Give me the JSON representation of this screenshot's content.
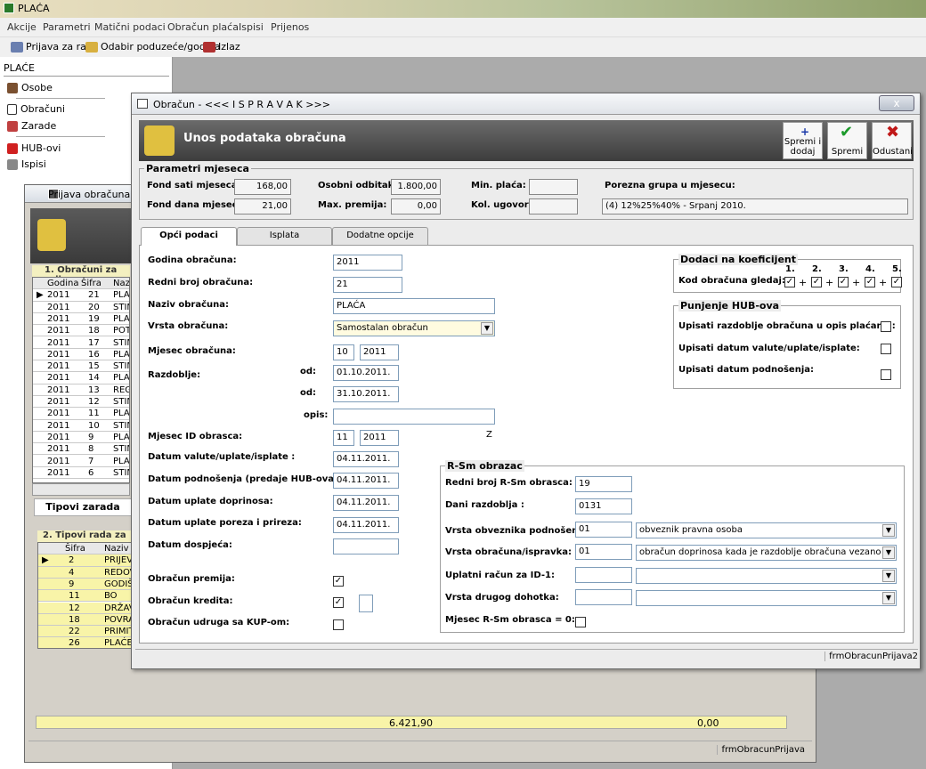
{
  "app": {
    "title": "PLAĆA"
  },
  "menu": [
    "Akcije",
    "Parametri",
    "Matični podaci",
    "Obračun plaća",
    "Ispisi",
    "Prijenos"
  ],
  "toolbar": {
    "login": "Prijava za rad",
    "company": "Odabir poduzeće/godina",
    "exit": "Izlaz"
  },
  "left": {
    "header": "PLAĆE",
    "items": [
      "Osobe",
      "Obračuni",
      "Zarade",
      "HUB-ovi",
      "Ispisi"
    ]
  },
  "back": {
    "title": "Prijava obračuna - (I",
    "grid1_title": "1. Obračuni za prije",
    "grid1_cols": [
      "Godina",
      "Šifra",
      "Naziv"
    ],
    "grid1_rows": [
      [
        "2011",
        "21",
        "PLA"
      ],
      [
        "2011",
        "20",
        "STIM"
      ],
      [
        "2011",
        "19",
        "PLA"
      ],
      [
        "2011",
        "18",
        "POT"
      ],
      [
        "2011",
        "17",
        "STIM"
      ],
      [
        "2011",
        "16",
        "PLA"
      ],
      [
        "2011",
        "15",
        "STIM"
      ],
      [
        "2011",
        "14",
        "PLA"
      ],
      [
        "2011",
        "13",
        "REG"
      ],
      [
        "2011",
        "12",
        "STIM"
      ],
      [
        "2011",
        "11",
        "PLA"
      ],
      [
        "2011",
        "10",
        "STIM"
      ],
      [
        "2011",
        "9",
        "PLA"
      ],
      [
        "2011",
        "8",
        "STIM"
      ],
      [
        "2011",
        "7",
        "PLA"
      ],
      [
        "2011",
        "6",
        "STIM"
      ]
    ],
    "tab_label": "Tipovi zarada",
    "grid2_title": "2. Tipovi rada za o",
    "grid2_cols": [
      "Šifra",
      "Naziv"
    ],
    "grid2_rows": [
      [
        "2",
        "PRIJEV"
      ],
      [
        "4",
        "REDOV"
      ],
      [
        "9",
        "GODIŠ"
      ],
      [
        "11",
        "BO RO"
      ],
      [
        "12",
        "DRŽAV"
      ],
      [
        "18",
        "POVRA"
      ],
      [
        "22",
        "PRIMIT"
      ],
      [
        "26",
        "PLAĆE"
      ]
    ],
    "total1": "6.421,90",
    "total2": "0,00",
    "status": "frmObracunPrijava"
  },
  "main": {
    "title": "Obračun -  <<< I S P R A V A K >>>",
    "close": "x",
    "banner_title": "Unos podataka obračuna",
    "btn_save_add": "Spremi i dodaj",
    "btn_save": "Spremi",
    "btn_cancel": "Odustani",
    "params": {
      "legend": "Parametri mjeseca",
      "fond_sati_label": "Fond sati mjeseca:",
      "fond_sati": "168,00",
      "fond_dana_label": "Fond dana mjeseca:",
      "fond_dana": "21,00",
      "osobni_label": "Osobni odbitak:",
      "osobni": "1.800,00",
      "max_premija_label": "Max. premija:",
      "max_premija": "0,00",
      "min_placa_label": "Min. plaća:",
      "min_placa": "",
      "kol_ugovor_label": "Kol. ugovor:",
      "kol_ugovor": "",
      "porezna_label": "Porezna grupa u mjesecu:",
      "porezna": "(4) 12%25%40% - Srpanj 2010."
    },
    "tabs": [
      "Opći podaci",
      "Isplata",
      "Dodatne opcije"
    ],
    "form": {
      "godina_label": "Godina obračuna:",
      "godina": "2011",
      "redni_label": "Redni broj obračuna:",
      "redni": "21",
      "naziv_label": "Naziv obračuna:",
      "naziv": "PLAĆA",
      "vrsta_label": "Vrsta obračuna:",
      "vrsta": "Samostalan obračun",
      "mjesec_label": "Mjesec obračuna:",
      "mjesec": "10",
      "mjesec_god": "2011",
      "razdoblje_label": "Razdoblje:",
      "od_label": "od:",
      "od": "01.10.2011.",
      "do_label": "od:",
      "do": "31.10.2011.",
      "opis_label": "opis:",
      "opis": "",
      "mjesec_id_label": "Mjesec ID obrasca:",
      "mjesec_id": "11",
      "mjesec_id_god": "2011",
      "z": "Z",
      "datum_valute_label": "Datum valute/uplate/isplate :",
      "datum_valute": "04.11.2011.",
      "datum_podn_label": "Datum podnošenja (predaje HUB-ova):",
      "datum_podn": "04.11.2011.",
      "datum_dopr_label": "Datum uplate doprinosa:",
      "datum_dopr": "04.11.2011.",
      "datum_poreza_label": "Datum uplate poreza i prireza:",
      "datum_poreza": "04.11.2011.",
      "datum_dosp_label": "Datum dospjeća:",
      "datum_dosp": "",
      "premija_label": "Obračun premija:",
      "kredita_label": "Obračun kredita:",
      "udruga_label": "Obračun udruga sa KUP-om:"
    },
    "koef": {
      "legend": "Dodaci na koeficijent",
      "label": "Kod obračuna gledaj:",
      "cols": [
        "1.",
        "2.",
        "3.",
        "4.",
        "5."
      ],
      "plus": "+"
    },
    "hub": {
      "legend": "Punjenje HUB-ova",
      "opt1": "Upisati razdoblje obračuna u opis plaćanja:",
      "opt2": "Upisati datum valute/uplate/isplate:",
      "opt3": "Upisati datum podnošenja:"
    },
    "rsm": {
      "legend": "R-Sm obrazac",
      "redni_label": "Redni broj R-Sm obrasca:",
      "redni": "19",
      "dani_label": "Dani razdoblja :",
      "dani": "0131",
      "obv_label": "Vrsta obveznika podnošenja",
      "obv_code": "01",
      "obv_text": "obveznik pravna osoba",
      "isp_label": "Vrsta obračuna/ispravka:",
      "isp_code": "01",
      "isp_text": "obračun doprinosa kada je razdoblje obračuna vezano za mjesec",
      "racun_label": "Uplatni račun za ID-1:",
      "dohodak_label": "Vrsta drugog dohotka:",
      "mjesec0_label": "Mjesec R-Sm obrasca = 0:"
    },
    "status": "frmObracunPrijava2"
  }
}
